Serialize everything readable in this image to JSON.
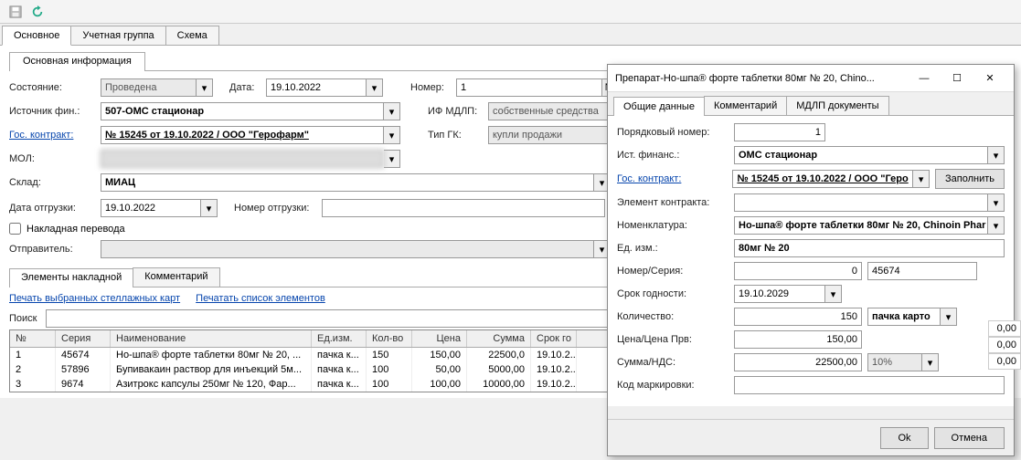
{
  "toolbar": {
    "save_icon": "save",
    "refresh_icon": "refresh"
  },
  "main_tabs": {
    "basic": "Основное",
    "group": "Учетная группа",
    "schema": "Схема"
  },
  "sub_tab": "Основная информация",
  "form": {
    "state_lbl": "Состояние:",
    "state_val": "Проведена",
    "date_lbl": "Дата:",
    "date_val": "19.10.2022",
    "number_lbl": "Номер:",
    "number_val": "1",
    "number_btn": "№",
    "fin_lbl": "Источник фин.:",
    "fin_val": "507-ОМС стационар",
    "mdlp_lbl": "ИФ МДЛП:",
    "mdlp_val": "собственные средства",
    "contract_lbl": "Гос. контракт:",
    "contract_val": "№ 15245 от 19.10.2022 / ООО \"Герофарм\"",
    "tipgk_lbl": "Тип ГК:",
    "tipgk_val": "купли продажи",
    "mol_lbl": "МОЛ:",
    "sklad_lbl": "Склад:",
    "sklad_val": "МИАЦ",
    "shipdate_lbl": "Дата отгрузки:",
    "shipdate_val": "19.10.2022",
    "shipno_lbl": "Номер отгрузки:",
    "shipno_val": "",
    "transfer_lbl": "Накладная перевода",
    "sender_lbl": "Отправитель:"
  },
  "elem_tabs": {
    "elems": "Элементы накладной",
    "comment": "Комментарий"
  },
  "links": {
    "print_cards": "Печать выбранных стеллажных карт",
    "print_list": "Печатать список элементов"
  },
  "search_lbl": "Поиск",
  "grid": {
    "head": {
      "no": "№",
      "ser": "Серия",
      "nm": "Наименование",
      "ed": "Ед.изм.",
      "kol": "Кол-во",
      "cena": "Цена",
      "sum": "Сумма",
      "srok": "Срок го"
    },
    "rows": [
      {
        "no": "1",
        "ser": "45674",
        "nm": "Но-шпа® форте таблетки 80мг № 20, ...",
        "ed": "пачка к...",
        "kol": "150",
        "cena": "150,00",
        "sum": "22500,0",
        "srok": "19.10.2..."
      },
      {
        "no": "2",
        "ser": "57896",
        "nm": "Бупивакаин раствор для инъекций 5м...",
        "ed": "пачка к...",
        "kol": "100",
        "cena": "50,00",
        "sum": "5000,00",
        "srok": "19.10.2..."
      },
      {
        "no": "3",
        "ser": "9674",
        "nm": "Азитрокс капсулы 250мг № 120, Фар...",
        "ed": "пачка к...",
        "kol": "100",
        "cena": "100,00",
        "sum": "10000,00",
        "srok": "19.10.2..."
      }
    ]
  },
  "dialog": {
    "title": "Препарат-Но-шпа® форте таблетки 80мг № 20, Chino...",
    "tabs": {
      "general": "Общие данные",
      "comment": "Комментарий",
      "mdlp": "МДЛП документы"
    },
    "ord_lbl": "Порядковый номер:",
    "ord_val": "1",
    "fin_lbl": "Ист. финанс.:",
    "fin_val": "ОМС стационар",
    "contract_lbl": "Гос. контракт:",
    "contract_val": "№ 15245 от 19.10.2022 / ООО \"Геро",
    "fill_btn": "Заполнить",
    "celem_lbl": "Элемент контракта:",
    "celem_val": "",
    "nomen_lbl": "Номенклатура:",
    "nomen_val": "Но-шпа® форте таблетки 80мг № 20, Chinoin Phar",
    "unit_lbl": "Ед. изм.:",
    "unit_val": "80мг № 20",
    "numser_lbl": "Номер/Серия:",
    "num_val": "0",
    "ser_val": "45674",
    "expiry_lbl": "Срок годности:",
    "expiry_val": "19.10.2029",
    "qty_lbl": "Количество:",
    "qty_val": "150",
    "qty_unit": "пачка карто",
    "price_lbl": "Цена/Цена Прв:",
    "price_val": "150,00",
    "sumnds_lbl": "Сумма/НДС:",
    "sum_val": "22500,00",
    "nds_val": "10%",
    "mark_lbl": "Код маркировки:",
    "ok": "Ok",
    "cancel": "Отмена"
  },
  "rightpeek": [
    "0,00",
    "0,00",
    "0,00"
  ]
}
